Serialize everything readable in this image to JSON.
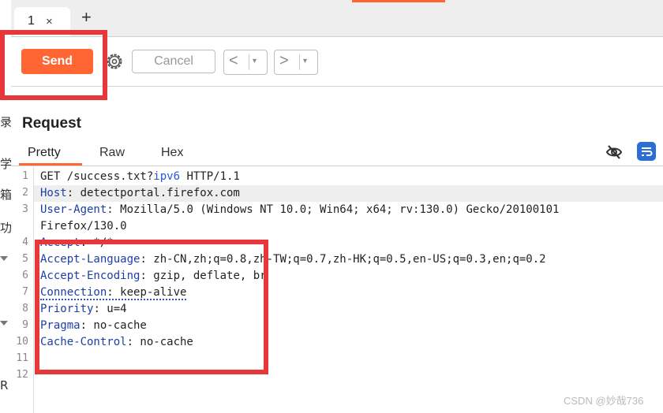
{
  "left_strip": {
    "glyphs": [
      "录",
      "学",
      "箱",
      "功",
      "R"
    ]
  },
  "tabs": [
    {
      "label": "1",
      "close": "×"
    }
  ],
  "tab_add": "+",
  "toolbar": {
    "send_label": "Send",
    "cancel_label": "Cancel",
    "back_label": "<",
    "forward_label": ">",
    "dropdown_glyph": "▾"
  },
  "request": {
    "title": "Request",
    "tabs": [
      "Pretty",
      "Raw",
      "Hex"
    ],
    "active_tab": "Pretty"
  },
  "editor": {
    "line_numbers": [
      "1",
      "2",
      "3",
      "4",
      "5",
      "6",
      "7",
      "8",
      "9",
      "10",
      "11",
      "12"
    ],
    "lines": [
      {
        "method": "GET /success.txt?",
        "param": "ipv6",
        "rest": " HTTP/1.1"
      },
      {
        "name": "Host",
        "value": ": detectportal.firefox.com"
      },
      {
        "name": "User-Agent",
        "value": ": Mozilla/5.0 (Windows NT 10.0; Win64; x64; rv:130.0) Gecko/20100101"
      },
      {
        "continuation": "Firefox/130.0"
      },
      {
        "name": "Accept",
        "value": ": */*"
      },
      {
        "name": "Accept-Language",
        "value": ": zh-CN,zh;q=0.8,zh-TW;q=0.7,zh-HK;q=0.5,en-US;q=0.3,en;q=0.2"
      },
      {
        "name": "Accept-Encoding",
        "value": ": gzip, deflate, br"
      },
      {
        "name": "Connection",
        "value": ": keep-alive"
      },
      {
        "name": "Priority",
        "value": ": u=4"
      },
      {
        "name": "Pragma",
        "value": ": no-cache"
      },
      {
        "name": "Cache-Control",
        "value": ": no-cache"
      }
    ]
  },
  "watermark": "CSDN @妙哉736",
  "colors": {
    "accent": "#ff6633",
    "highlight_box": "#e8373a",
    "header_name": "#1c3fa6",
    "wrap_button": "#2b6fd6"
  },
  "icons": {
    "settings": "gear-icon",
    "hide": "eye-slash-icon",
    "wrap": "wrap-lines-icon"
  }
}
